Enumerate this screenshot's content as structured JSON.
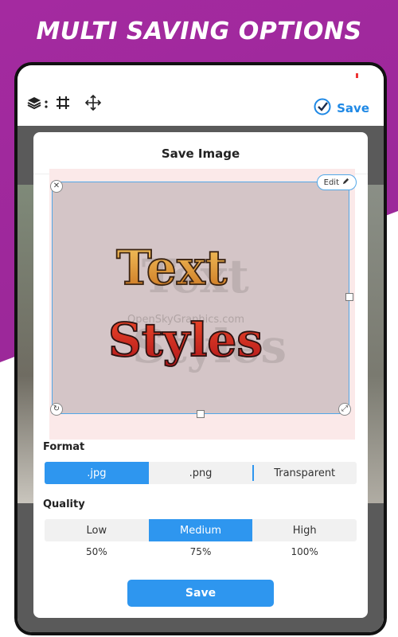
{
  "promo": {
    "headline": "MULTI SAVING OPTIONS"
  },
  "toolbar": {
    "icons": [
      "layers-icon",
      "more-vert-icon",
      "grid-icon",
      "move-icon"
    ],
    "save_label": "Save",
    "accent": "#1e88e5"
  },
  "dialog": {
    "title": "Save Image",
    "edit_label": "Edit",
    "artwork_lines": [
      "Text",
      "Styles"
    ],
    "watermark": "OpenSkyGraphics.com",
    "format": {
      "label": "Format",
      "options": [
        ".jpg",
        ".png",
        "Transparent"
      ],
      "selected": ".jpg"
    },
    "quality": {
      "label": "Quality",
      "options": [
        "Low",
        "Medium",
        "High"
      ],
      "percents": [
        "50%",
        "75%",
        "100%"
      ],
      "selected": "Medium"
    },
    "save_label": "Save",
    "accent": "#2e96ef"
  }
}
